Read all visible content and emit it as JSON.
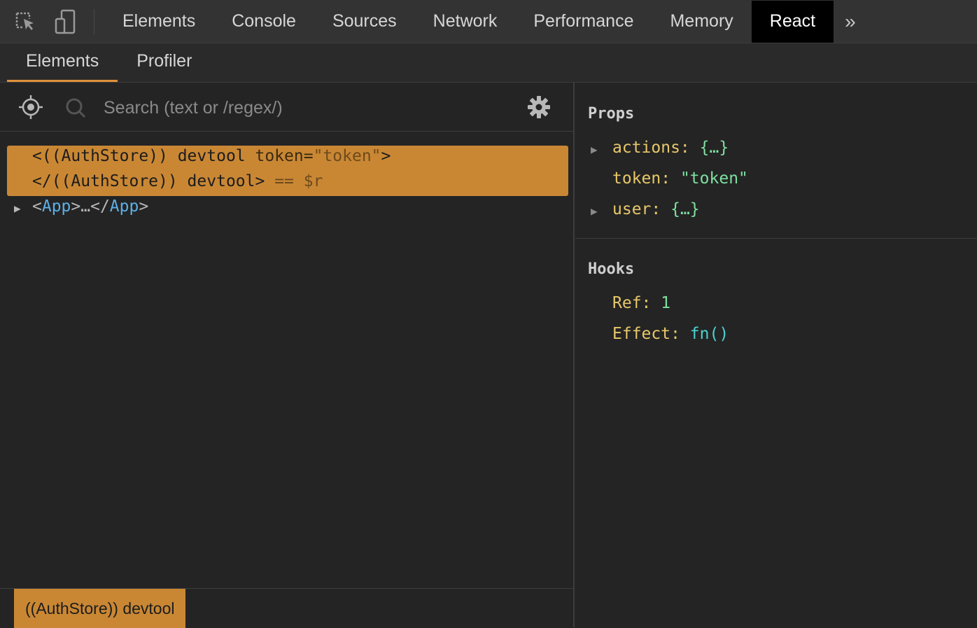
{
  "toolbar": {
    "tabs": [
      "Elements",
      "Console",
      "Sources",
      "Network",
      "Performance",
      "Memory",
      "React"
    ],
    "active_tab": "React",
    "more_label": "»"
  },
  "subtabs": {
    "items": [
      "Elements",
      "Profiler"
    ],
    "active": "Elements"
  },
  "search": {
    "placeholder": "Search (text or /regex/)"
  },
  "tree": {
    "selected_open": "<((AuthStore)) devtool",
    "selected_attr_name": " token=",
    "selected_attr_value": "\"token\"",
    "selected_open_end": ">",
    "selected_close": "</((AuthStore)) devtool>",
    "selected_ref": " == $r",
    "child_open_lt": "<",
    "child_name": "App",
    "child_mid": ">…</",
    "child_close_name": "App",
    "child_close_gt": ">"
  },
  "breadcrumb": {
    "label": "((AuthStore)) devtool"
  },
  "props": {
    "title": "Props",
    "items": [
      {
        "key": "actions:",
        "value": "{…}"
      },
      {
        "key": "token:",
        "value": "\"token\""
      },
      {
        "key": "user:",
        "value": "{…}"
      }
    ]
  },
  "hooks": {
    "title": "Hooks",
    "items": [
      {
        "key": "Ref:",
        "value": "1"
      },
      {
        "key": "Effect:",
        "value": "fn()"
      }
    ]
  },
  "colors": {
    "accent": "#c98734",
    "tab_active_bg": "#000000",
    "key": "#e8c86a",
    "value": "#7ee0a0",
    "fn": "#4ad2d0",
    "component": "#5db0e6"
  }
}
